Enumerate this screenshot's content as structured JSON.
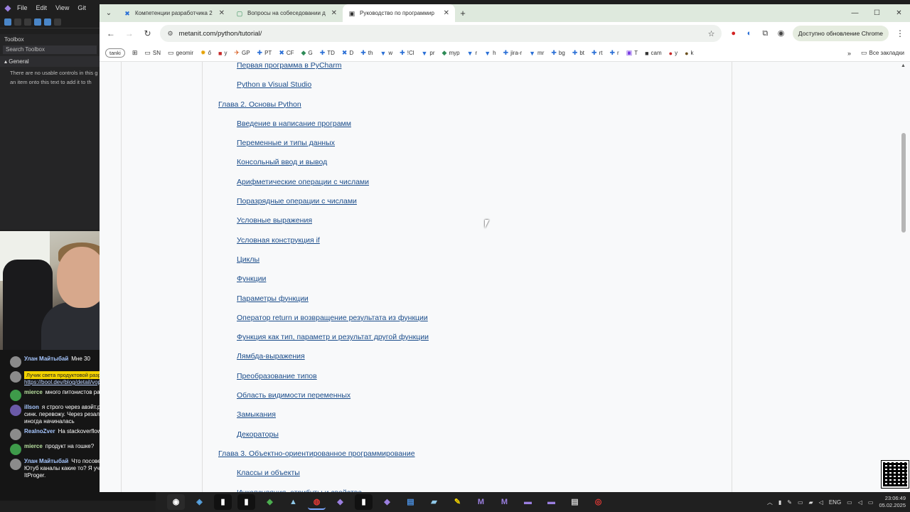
{
  "vs": {
    "menu": [
      "File",
      "Edit",
      "View",
      "Git"
    ],
    "toolbox": {
      "title": "Toolbox",
      "search_placeholder": "Search Toolbox",
      "group": "General",
      "empty_line1": "There are no usable controls in this g",
      "empty_line2": "an item onto this text to add it to th"
    }
  },
  "chat": {
    "messages": [
      {
        "nick": "Улан Майтыбай",
        "text": "Мне 30",
        "avatar": "gray"
      },
      {
        "highlight": "Лучик света продуктовой разработки",
        "link": "https://bool.dev/blog/detail/voprosy-...",
        "avatar": "gray"
      },
      {
        "nick": "mierce",
        "text": "много питонистов развелось",
        "avatar": "green"
      },
      {
        "nick": "illson",
        "text": "я строго через авэйт.резалт в асинк код в синк. перевожу. Через резалт пиздарезка иногда начиналась",
        "avatar": "green"
      },
      {
        "nick": "RealnoZver",
        "text": "На stackoverflow ахеренный ответ",
        "avatar": "gray"
      },
      {
        "nick": "mierce",
        "text": "продукт на гошке?",
        "avatar": "green"
      },
      {
        "nick": "Улан Майтыбай",
        "text": "Что посоветуете? Может Ютуб каналы какие то? Я учусь на сайте ItProger.",
        "avatar": "gray"
      }
    ]
  },
  "browser": {
    "tabs": [
      {
        "title": "Компетенции разработчика 2",
        "icon": "x-icon",
        "active": false
      },
      {
        "title": "Вопросы на собеседовании д",
        "icon": "doc-icon",
        "active": false
      },
      {
        "title": "Руководство по программир",
        "icon": "metanit-icon",
        "active": true
      }
    ],
    "url": "metanit.com/python/tutorial/",
    "update_label": "Доступно обновление Chrome",
    "bookmarks_first": "tanki",
    "bookmarks": [
      "SN",
      "geomir",
      "ő",
      "y",
      "GP",
      "PT",
      "CF",
      "G",
      "TD",
      "D",
      "th",
      "w",
      "!Cl",
      "pr",
      "myp",
      "r",
      "h",
      "jira-r",
      "mr",
      "bg",
      "bt",
      "rt",
      "r",
      "T",
      "cam",
      "y",
      "k"
    ],
    "all_bookmarks": "Все закладки"
  },
  "toc": [
    {
      "type": "item",
      "text": "Первая программа в PyCharm"
    },
    {
      "type": "item",
      "text": "Python в Visual Studio"
    },
    {
      "type": "chapter",
      "text": "Глава 2. Основы Python"
    },
    {
      "type": "item",
      "text": "Введение в написание программ"
    },
    {
      "type": "item",
      "text": "Переменные и типы данных"
    },
    {
      "type": "item",
      "text": "Консольный ввод и вывод"
    },
    {
      "type": "item",
      "text": "Арифметические операции с числами"
    },
    {
      "type": "item",
      "text": "Поразрядные операции с числами"
    },
    {
      "type": "item",
      "text": "Условные выражения"
    },
    {
      "type": "item",
      "text": "Условная конструкция if"
    },
    {
      "type": "item",
      "text": "Циклы"
    },
    {
      "type": "item",
      "text": "Функции"
    },
    {
      "type": "item",
      "text": "Параметры функции"
    },
    {
      "type": "item",
      "text": "Оператор return и возвращение результата из функции"
    },
    {
      "type": "item",
      "text": "Функция как тип, параметр и результат другой функции"
    },
    {
      "type": "item",
      "text": "Лямбда-выражения"
    },
    {
      "type": "item",
      "text": "Преобразование типов"
    },
    {
      "type": "item",
      "text": "Область видимости переменных"
    },
    {
      "type": "item",
      "text": "Замыкания"
    },
    {
      "type": "item",
      "text": "Декораторы"
    },
    {
      "type": "chapter",
      "text": "Глава 3. Объектно-ориентированное программирование"
    },
    {
      "type": "item",
      "text": "Классы и объекты"
    },
    {
      "type": "item",
      "text": "Инкапсуляция, атрибуты и свойства"
    }
  ],
  "taskbar": {
    "lang": "ENG",
    "time": "23:06:49",
    "date": "05.02.2025"
  },
  "colors": {
    "link": "#1a4c8a",
    "tabstrip": "#dee9dd",
    "chat_highlight": "#f2d200"
  }
}
